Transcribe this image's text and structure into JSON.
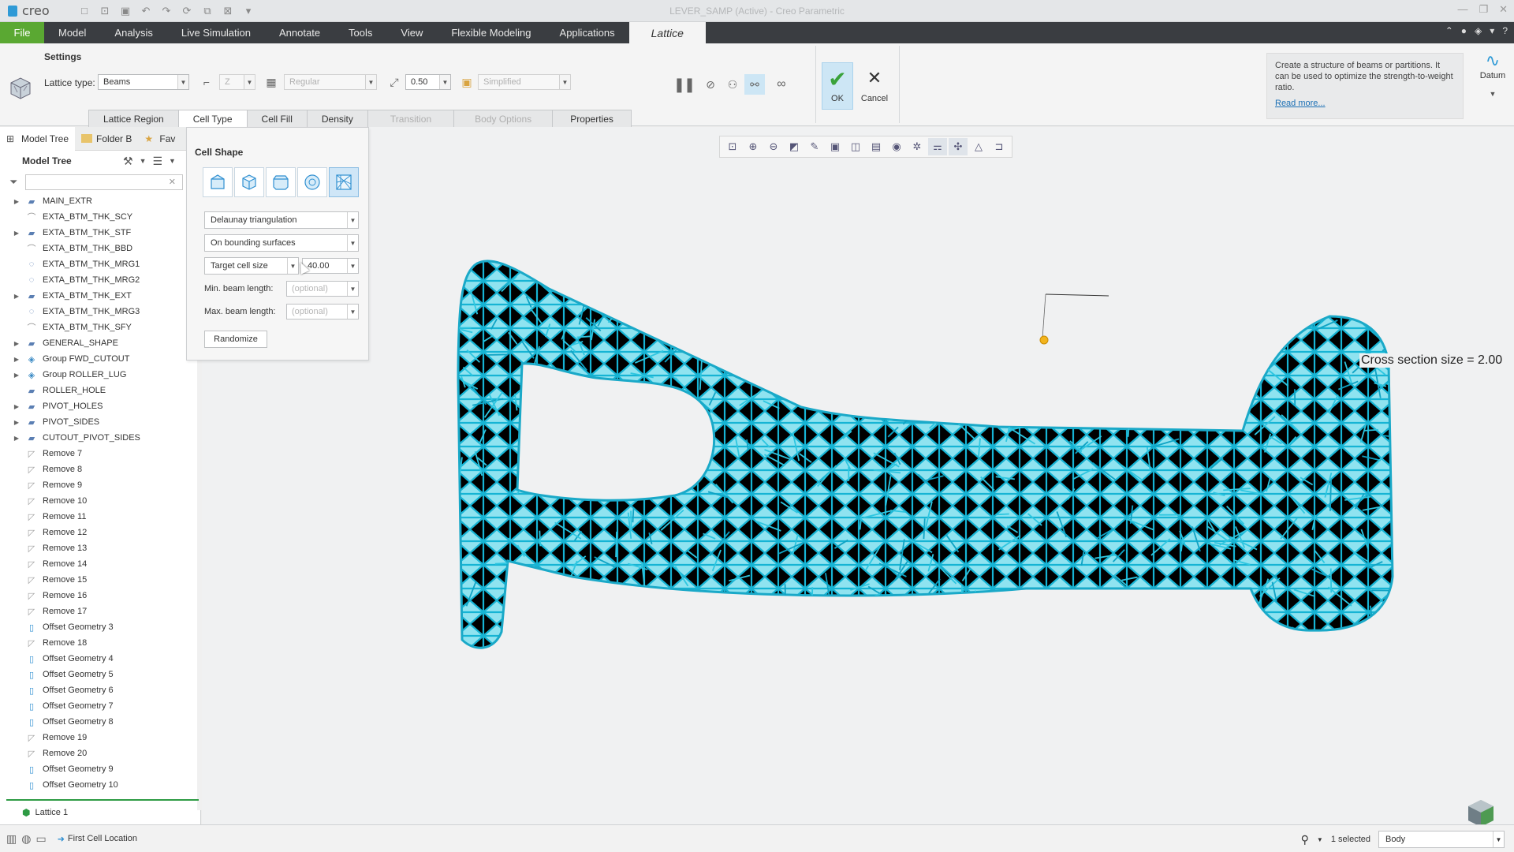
{
  "app": {
    "logo_text": "creo",
    "window_title": "LEVER_SAMP (Active) - Creo Parametric"
  },
  "ribbon_tabs": [
    "File",
    "Model",
    "Analysis",
    "Live Simulation",
    "Annotate",
    "Tools",
    "View",
    "Flexible Modeling",
    "Applications",
    "Lattice"
  ],
  "settings": {
    "group_title": "Settings",
    "lattice_type_label": "Lattice type:",
    "lattice_type_value": "Beams",
    "axis_value": "Z",
    "pattern_value": "Regular",
    "scale_value": "0.50",
    "representation_value": "Simplified"
  },
  "actions": {
    "ok_label": "OK",
    "cancel_label": "Cancel"
  },
  "help": {
    "text": "Create a structure of beams or partitions. It can be used to optimize the strength-to-weight ratio.",
    "link": "Read more..."
  },
  "datum_label": "Datum",
  "sub_tabs": [
    "Lattice Region",
    "Cell Type",
    "Cell Fill",
    "Density",
    "Transition",
    "Body Options",
    "Properties"
  ],
  "left_panel": {
    "tabs": [
      "Model Tree",
      "Folder B",
      "Fav"
    ],
    "title": "Model Tree",
    "items": [
      {
        "label": "MAIN_EXTR",
        "icon": "extrude-icon",
        "expandable": true
      },
      {
        "label": "EXTA_BTM_THK_SCY",
        "icon": "sketch-icon",
        "expandable": false
      },
      {
        "label": "EXTA_BTM_THK_STF",
        "icon": "extrude-icon",
        "expandable": true
      },
      {
        "label": "EXTA_BTM_THK_BBD",
        "icon": "sketch-icon",
        "expandable": false
      },
      {
        "label": "EXTA_BTM_THK_MRG1",
        "icon": "merge-icon",
        "expandable": false
      },
      {
        "label": "EXTA_BTM_THK_MRG2",
        "icon": "merge-icon",
        "expandable": false
      },
      {
        "label": "EXTA_BTM_THK_EXT",
        "icon": "extrude-icon",
        "expandable": true
      },
      {
        "label": "EXTA_BTM_THK_MRG3",
        "icon": "merge-icon",
        "expandable": false
      },
      {
        "label": "EXTA_BTM_THK_SFY",
        "icon": "sketch-icon",
        "expandable": false
      },
      {
        "label": "GENERAL_SHAPE",
        "icon": "extrude-icon",
        "expandable": true
      },
      {
        "label": "Group FWD_CUTOUT",
        "icon": "group-icon",
        "expandable": true
      },
      {
        "label": "Group ROLLER_LUG",
        "icon": "group-icon",
        "expandable": true
      },
      {
        "label": "ROLLER_HOLE",
        "icon": "extrude-icon",
        "expandable": false
      },
      {
        "label": "PIVOT_HOLES",
        "icon": "extrude-icon",
        "expandable": true
      },
      {
        "label": "PIVOT_SIDES",
        "icon": "extrude-icon",
        "expandable": true
      },
      {
        "label": "CUTOUT_PIVOT_SIDES",
        "icon": "extrude-icon",
        "expandable": true
      },
      {
        "label": "Remove 7",
        "icon": "remove-icon",
        "expandable": false
      },
      {
        "label": "Remove 8",
        "icon": "remove-icon",
        "expandable": false
      },
      {
        "label": "Remove 9",
        "icon": "remove-icon",
        "expandable": false
      },
      {
        "label": "Remove 10",
        "icon": "remove-icon",
        "expandable": false
      },
      {
        "label": "Remove 11",
        "icon": "remove-icon",
        "expandable": false
      },
      {
        "label": "Remove 12",
        "icon": "remove-icon",
        "expandable": false
      },
      {
        "label": "Remove 13",
        "icon": "remove-icon",
        "expandable": false
      },
      {
        "label": "Remove 14",
        "icon": "remove-icon",
        "expandable": false
      },
      {
        "label": "Remove 15",
        "icon": "remove-icon",
        "expandable": false
      },
      {
        "label": "Remove 16",
        "icon": "remove-icon",
        "expandable": false
      },
      {
        "label": "Remove 17",
        "icon": "remove-icon",
        "expandable": false
      },
      {
        "label": "Offset Geometry 3",
        "icon": "offset-icon",
        "expandable": false
      },
      {
        "label": "Remove 18",
        "icon": "remove-icon",
        "expandable": false
      },
      {
        "label": "Offset Geometry 4",
        "icon": "offset-icon",
        "expandable": false
      },
      {
        "label": "Offset Geometry 5",
        "icon": "offset-icon",
        "expandable": false
      },
      {
        "label": "Offset Geometry 6",
        "icon": "offset-icon",
        "expandable": false
      },
      {
        "label": "Offset Geometry 7",
        "icon": "offset-icon",
        "expandable": false
      },
      {
        "label": "Offset Geometry 8",
        "icon": "offset-icon",
        "expandable": false
      },
      {
        "label": "Remove 19",
        "icon": "remove-icon",
        "expandable": false
      },
      {
        "label": "Remove 20",
        "icon": "remove-icon",
        "expandable": false
      },
      {
        "label": "Offset Geometry 9",
        "icon": "offset-icon",
        "expandable": false
      },
      {
        "label": "Offset Geometry 10",
        "icon": "offset-icon",
        "expandable": false
      }
    ],
    "active_feature": "Lattice 1"
  },
  "cell_type_panel": {
    "title": "Cell Shape",
    "method": "Delaunay triangulation",
    "placement": "On bounding surfaces",
    "size_mode": "Target cell size",
    "size_value": "40.00",
    "min_beam_label": "Min. beam length:",
    "min_beam_placeholder": "(optional)",
    "max_beam_label": "Max. beam length:",
    "max_beam_placeholder": "(optional)",
    "randomize_label": "Randomize"
  },
  "graphics": {
    "cross_section_label": "Cross section size = 2.00",
    "lattice_color": "#2ec6e0"
  },
  "status": {
    "message": "First Cell Location",
    "selected": "1 selected",
    "filter": "Body"
  }
}
